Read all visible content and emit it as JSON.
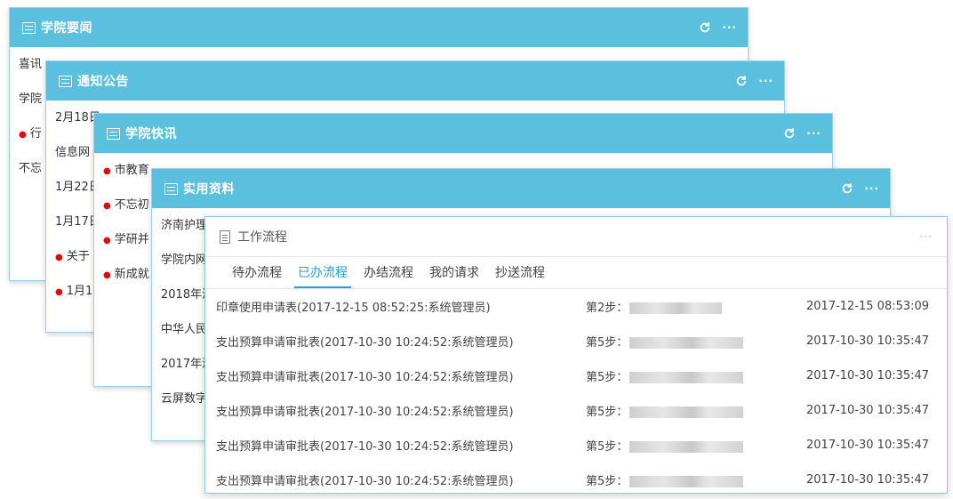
{
  "cards": [
    {
      "title": "学院要闻",
      "items": [
        {
          "text": "喜讯",
          "dot": false
        },
        {
          "text": "学院",
          "dot": false
        },
        {
          "text": "行",
          "dot": true
        },
        {
          "text": "不忘",
          "dot": false
        }
      ]
    },
    {
      "title": "通知公告",
      "items": [
        {
          "text": "2月18日",
          "dot": false
        },
        {
          "text": "信息网",
          "dot": false
        },
        {
          "text": "1月22日",
          "dot": false
        },
        {
          "text": "1月17日",
          "dot": false
        },
        {
          "text": "关于",
          "dot": true
        },
        {
          "text": "1月1",
          "dot": true
        }
      ]
    },
    {
      "title": "学院快讯",
      "items": [
        {
          "text": "市教育",
          "dot": true
        },
        {
          "text": "不忘初",
          "dot": true
        },
        {
          "text": "学研并",
          "dot": true
        },
        {
          "text": "新成就",
          "dot": true
        }
      ]
    },
    {
      "title": "实用资料",
      "items": [
        {
          "text": "济南护理",
          "dot": false
        },
        {
          "text": "学院内网",
          "dot": false
        },
        {
          "text": "2018年济",
          "dot": false
        },
        {
          "text": "中华人民",
          "dot": false
        },
        {
          "text": "2017年济",
          "dot": false
        },
        {
          "text": "云屏数字",
          "dot": false
        }
      ]
    }
  ],
  "workflow": {
    "title": "工作流程",
    "more": "···",
    "tabs": [
      "待办流程",
      "已办流程",
      "办结流程",
      "我的请求",
      "抄送流程"
    ],
    "active_tab": 1,
    "rows": [
      {
        "name": "印章使用申请表(2017-12-15 08:52:25:系统管理员)",
        "step": "第2步：",
        "time": "2017-12-15 08:53:09"
      },
      {
        "name": "支出预算申请审批表(2017-10-30 10:24:52:系统管理员)",
        "step": "第5步：",
        "time": "2017-10-30 10:35:47"
      },
      {
        "name": "支出预算申请审批表(2017-10-30 10:24:52:系统管理员)",
        "step": "第5步：",
        "time": "2017-10-30 10:35:47"
      },
      {
        "name": "支出预算申请审批表(2017-10-30 10:24:52:系统管理员)",
        "step": "第5步：",
        "time": "2017-10-30 10:35:47"
      },
      {
        "name": "支出预算申请审批表(2017-10-30 10:24:52:系统管理员)",
        "step": "第5步：",
        "time": "2017-10-30 10:35:47"
      },
      {
        "name": "支出预算申请审批表(2017-10-30 10:24:52:系统管理员)",
        "step": "第5步：",
        "time": "2017-10-30 10:35:47"
      }
    ]
  },
  "header_tools": {
    "more": "···"
  },
  "colors": {
    "header_bg": "#5bc0de",
    "active_tab": "#2a9fd6",
    "dot": "#e00000"
  }
}
